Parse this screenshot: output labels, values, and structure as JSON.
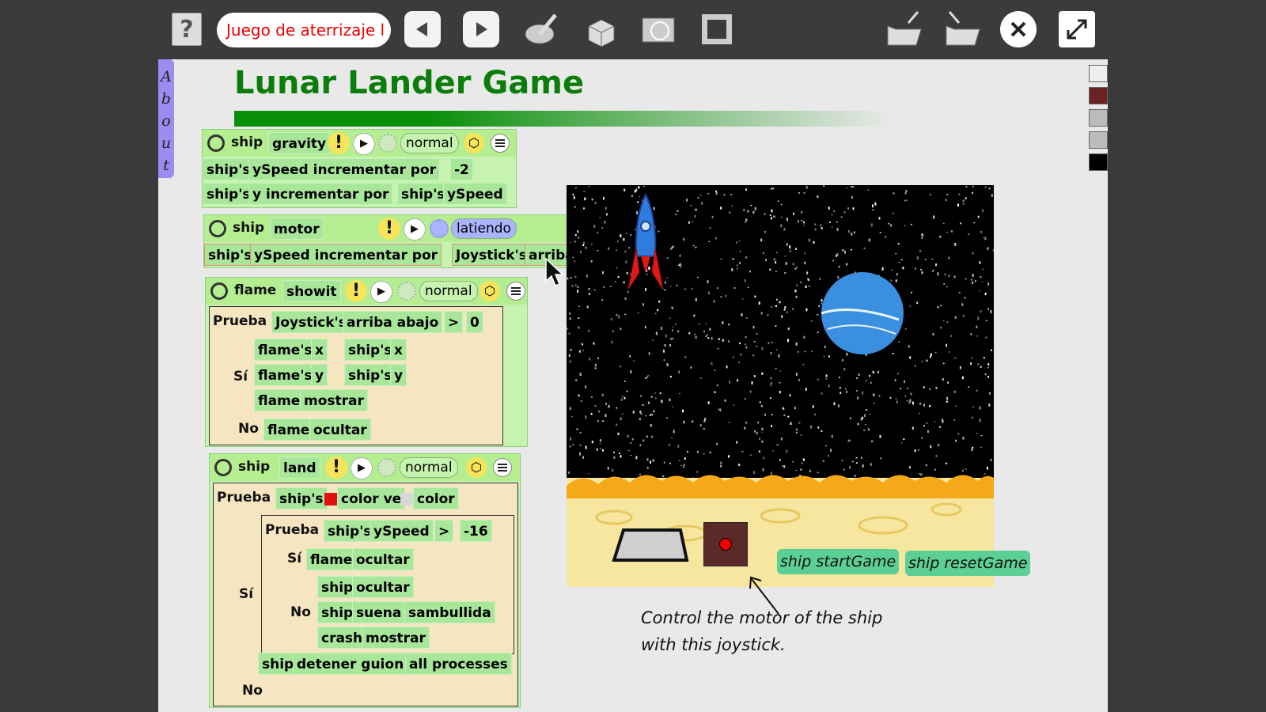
{
  "toolbar": {
    "help_label": "?",
    "project_name": "Juego de aterrizaje l",
    "icons": [
      "question-icon",
      "back-icon",
      "forward-icon",
      "paint-icon",
      "object-icon",
      "world-icon",
      "fullscreen-frame-icon",
      "load-project-icon",
      "save-project-icon",
      "close-icon",
      "expand-icon"
    ]
  },
  "about_flap": {
    "letters": [
      "A",
      "b",
      "o",
      "u",
      "t"
    ]
  },
  "page": {
    "title": "Lunar Lander Game"
  },
  "scripts": {
    "gravity": {
      "actor": "ship",
      "name": "gravity",
      "status": "normal",
      "row1": {
        "obj": "ship's",
        "prop": "ySpeed incrementar por",
        "val": "-2"
      },
      "row2": {
        "obj": "ship's",
        "prop": "y incrementar por",
        "arg_obj": "ship's",
        "arg_prop": "ySpeed"
      }
    },
    "motor": {
      "actor": "ship",
      "name": "motor",
      "status": "latiendo",
      "row1": {
        "obj": "ship's",
        "prop": "ySpeed incrementar por",
        "arg_obj": "Joystick's",
        "arg_prop": "arriba abajo"
      }
    },
    "showit": {
      "actor": "flame",
      "name": "showit",
      "status": "normal",
      "test_label": "Prueba",
      "test": {
        "obj": "Joystick's",
        "prop": "arriba abajo",
        "op": ">",
        "val": "0"
      },
      "yes_label": "Sí",
      "yes": [
        {
          "obj": "flame's",
          "prop": "x",
          "arrow": "←",
          "arg_obj": "ship's",
          "arg_prop": "x"
        },
        {
          "obj": "flame's",
          "prop": "y",
          "arrow": "←",
          "arg_obj": "ship's",
          "arg_prop": "y"
        },
        {
          "obj": "flame",
          "cmd": "mostrar"
        }
      ],
      "no_label": "No",
      "no": {
        "obj": "flame",
        "cmd": "ocultar"
      }
    },
    "land": {
      "actor": "ship",
      "name": "land",
      "status": "normal",
      "test_label": "Prueba",
      "test": {
        "obj": "ship's",
        "prop": "color ve",
        "prop2": "color"
      },
      "inner_test_label": "Prueba",
      "inner_test": {
        "obj": "ship's",
        "prop": "ySpeed",
        "op": ">",
        "val": "-16"
      },
      "inner_yes_label": "Sí",
      "inner_yes": {
        "obj": "flame",
        "cmd": "ocultar"
      },
      "inner_no_label": "No",
      "inner_no": [
        {
          "obj": "ship",
          "cmd": "ocultar"
        },
        {
          "obj": "ship",
          "cmd": "suena",
          "arg": "sambullida"
        },
        {
          "obj": "crash",
          "cmd": "mostrar"
        }
      ],
      "yes_label": "Sí",
      "stop": {
        "obj": "ship",
        "cmd": "detener guion",
        "arg": "all processes"
      },
      "no_label": "No"
    }
  },
  "game": {
    "start_button": "ship startGame",
    "reset_button": "ship resetGame"
  },
  "caption": {
    "line1": "Control the motor of the ship",
    "line2": "with this joystick."
  },
  "colors": {
    "title": "#0b7d0b",
    "script_bg": "#c7f3b0",
    "tile": "#a8e69a",
    "ground": "#f7e6a0",
    "planet": "#3a8fe0"
  }
}
